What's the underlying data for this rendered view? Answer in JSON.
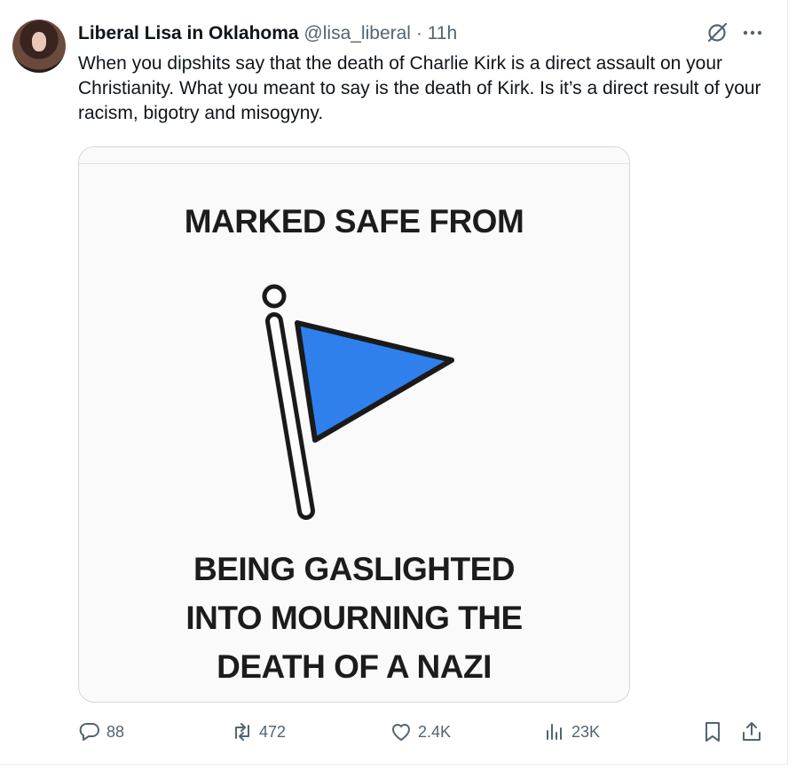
{
  "author": {
    "display_name": "Liberal Lisa in Oklahoma",
    "handle": "@lisa_liberal",
    "separator": "·",
    "time": "11h"
  },
  "tweet": {
    "text": "When you dipshits say that the death of Charlie Kirk is a direct assault on your Christianity. What you meant to say is the death of Kirk. Is it’s a direct result of your racism, bigotry and misogyny."
  },
  "media": {
    "top_text": "MARKED SAFE FROM",
    "bottom_text": "BEING GASLIGHTED INTO MOURNING THE DEATH OF A NAZI",
    "flag_color": "#2f80ed"
  },
  "actions": {
    "replies": "88",
    "reposts": "472",
    "likes": "2.4K",
    "views": "23K"
  },
  "icons": [
    "grok-icon",
    "more-icon",
    "reply-icon",
    "repost-icon",
    "like-icon",
    "views-icon",
    "bookmark-icon",
    "share-icon"
  ],
  "colors": {
    "text_primary": "#0f1419",
    "text_secondary": "#536471",
    "border": "#cfd9de"
  }
}
